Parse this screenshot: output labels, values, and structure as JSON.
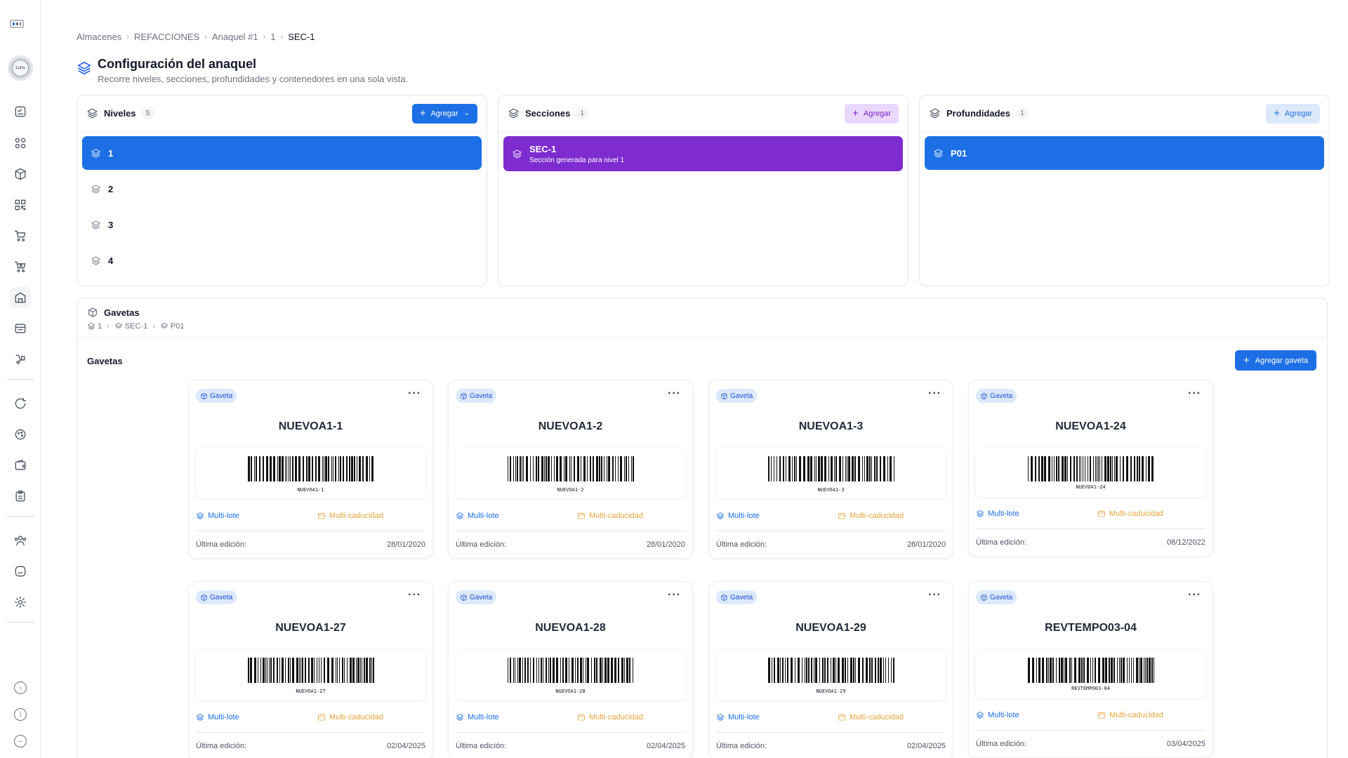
{
  "breadcrumb": [
    "Almacenes",
    "REFACCIONES",
    "Anaquel #1",
    "1",
    "SEC-1"
  ],
  "header": {
    "title": "Configuración del anaquel",
    "subtitle": "Recorre niveles, secciones, profundidades y contenedores en una sola vista."
  },
  "sidebar": {
    "avatar_text": "Lunu",
    "icons": [
      "clipboard-check-icon",
      "grid-icon",
      "box-icon",
      "qr-icon",
      "cart-check-icon",
      "cart-x-icon",
      "warehouse-icon",
      "inventory-icon",
      "truck-icon",
      "refresh-icon",
      "palette-icon",
      "wallet-icon",
      "clipboard-icon",
      "users-icon",
      "chat-icon",
      "settings-icon"
    ]
  },
  "niveles": {
    "title": "Niveles",
    "count": "5",
    "add_label": "Agregar",
    "items": [
      "1",
      "2",
      "3",
      "4"
    ]
  },
  "secciones": {
    "title": "Secciones",
    "count": "1",
    "add_label": "Agregar",
    "items": [
      {
        "name": "SEC-1",
        "desc": "Sección generada para nivel 1"
      }
    ]
  },
  "profundidades": {
    "title": "Profundidades",
    "count": "1",
    "add_label": "Agregar",
    "items": [
      "P01"
    ]
  },
  "gavetas": {
    "title": "Gavetas",
    "crumb": [
      "1",
      "SEC-1",
      "P01"
    ],
    "label": "Gavetas",
    "add_label": "Agregar gaveta",
    "cards": [
      {
        "badge": "Gaveta",
        "name": "NUEVOA1-1",
        "code": "NUEVOA1-1",
        "lote": "Multi-lote",
        "caducidad": "Multi-caducidad",
        "edit_label": "Última edición:",
        "date": "28/01/2020"
      },
      {
        "badge": "Gaveta",
        "name": "NUEVOA1-2",
        "code": "NUEVOA1-2",
        "lote": "Multi-lote",
        "caducidad": "Multi-caducidad",
        "edit_label": "Última edición:",
        "date": "28/01/2020"
      },
      {
        "badge": "Gaveta",
        "name": "NUEVOA1-3",
        "code": "NUEVOA1-3",
        "lote": "Multi-lote",
        "caducidad": "Multi-caducidad",
        "edit_label": "Última edición:",
        "date": "28/01/2020"
      },
      {
        "badge": "Gaveta",
        "name": "NUEVOA1-24",
        "code": "NUEVOA1-24",
        "lote": "Multi-lote",
        "caducidad": "Multi-caducidad",
        "edit_label": "Última edición:",
        "date": "08/12/2022"
      },
      {
        "badge": "Gaveta",
        "name": "NUEVOA1-27",
        "code": "NUEVOA1-27",
        "lote": "Multi-lote",
        "caducidad": "Multi-caducidad",
        "edit_label": "Última edición:",
        "date": "02/04/2025"
      },
      {
        "badge": "Gaveta",
        "name": "NUEVOA1-28",
        "code": "NUEVOA1-28",
        "lote": "Multi-lote",
        "caducidad": "Multi-caducidad",
        "edit_label": "Última edición:",
        "date": "02/04/2025"
      },
      {
        "badge": "Gaveta",
        "name": "NUEVOA1-29",
        "code": "NUEVOA1-29",
        "lote": "Multi-lote",
        "caducidad": "Multi-caducidad",
        "edit_label": "Última edición:",
        "date": "02/04/2025"
      },
      {
        "badge": "Gaveta",
        "name": "REVTEMPO03-04",
        "code": "REVTEMPO03-04",
        "lote": "Multi-lote",
        "caducidad": "Multi-caducidad",
        "edit_label": "Última edición:",
        "date": "03/04/2025"
      }
    ]
  },
  "colors": {
    "primary": "#1d6fe6",
    "purple": "#7e2ccf",
    "amber": "#e8a33a"
  }
}
